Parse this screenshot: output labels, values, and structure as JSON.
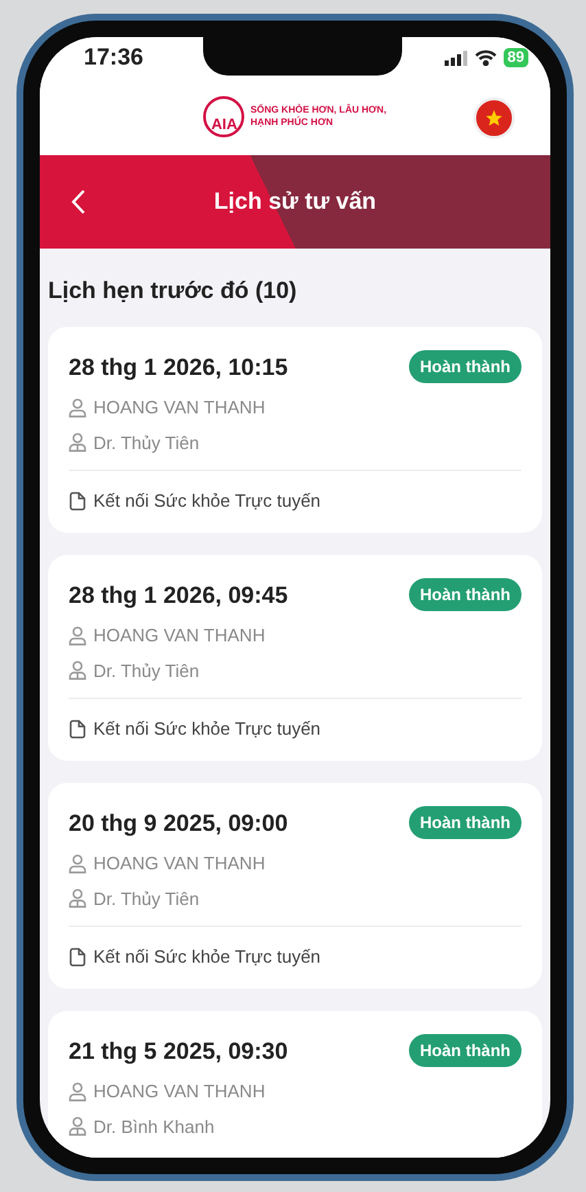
{
  "status_bar": {
    "time": "17:36",
    "battery": "89"
  },
  "header": {
    "logo_mark": "AIA",
    "slogan_lines": [
      "SỐNG KHỎE HƠN, LÂU HƠN,",
      "HẠNH PHÚC HƠN"
    ]
  },
  "title_bar": {
    "title": "Lịch sử tư vấn"
  },
  "section": {
    "title": "Lịch hẹn trước đó (10)"
  },
  "appointments": [
    {
      "datetime": "28 thg 1 2026, 10:15",
      "status": "Hoàn thành",
      "patient": "HOANG VAN THANH",
      "doctor": "Dr. Thủy Tiên",
      "service": "Kết nối Sức khỏe Trực tuyến"
    },
    {
      "datetime": "28 thg 1 2026, 09:45",
      "status": "Hoàn thành",
      "patient": "HOANG VAN THANH",
      "doctor": "Dr. Thủy Tiên",
      "service": "Kết nối Sức khỏe Trực tuyến"
    },
    {
      "datetime": "20 thg 9 2025, 09:00",
      "status": "Hoàn thành",
      "patient": "HOANG VAN THANH",
      "doctor": "Dr. Thủy Tiên",
      "service": "Kết nối Sức khỏe Trực tuyến"
    },
    {
      "datetime": "21 thg 5 2025, 09:30",
      "status": "Hoàn thành",
      "patient": "HOANG VAN THANH",
      "doctor": "Dr. Bình Khanh"
    }
  ]
}
